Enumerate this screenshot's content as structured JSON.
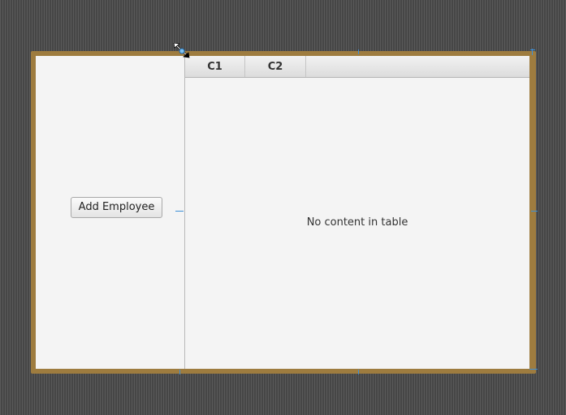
{
  "sidebar": {
    "add_button_label": "Add Employee"
  },
  "table": {
    "columns": [
      "C1",
      "C2"
    ],
    "placeholder": "No content in table"
  },
  "colors": {
    "background": "#4a4a4a",
    "pane_border": "#9e7c3f",
    "pane_fill": "#f3f3f3",
    "anchor_marker": "#3d8fd6"
  },
  "icons": {
    "cursor": "resize-diagonal-cursor-icon"
  }
}
